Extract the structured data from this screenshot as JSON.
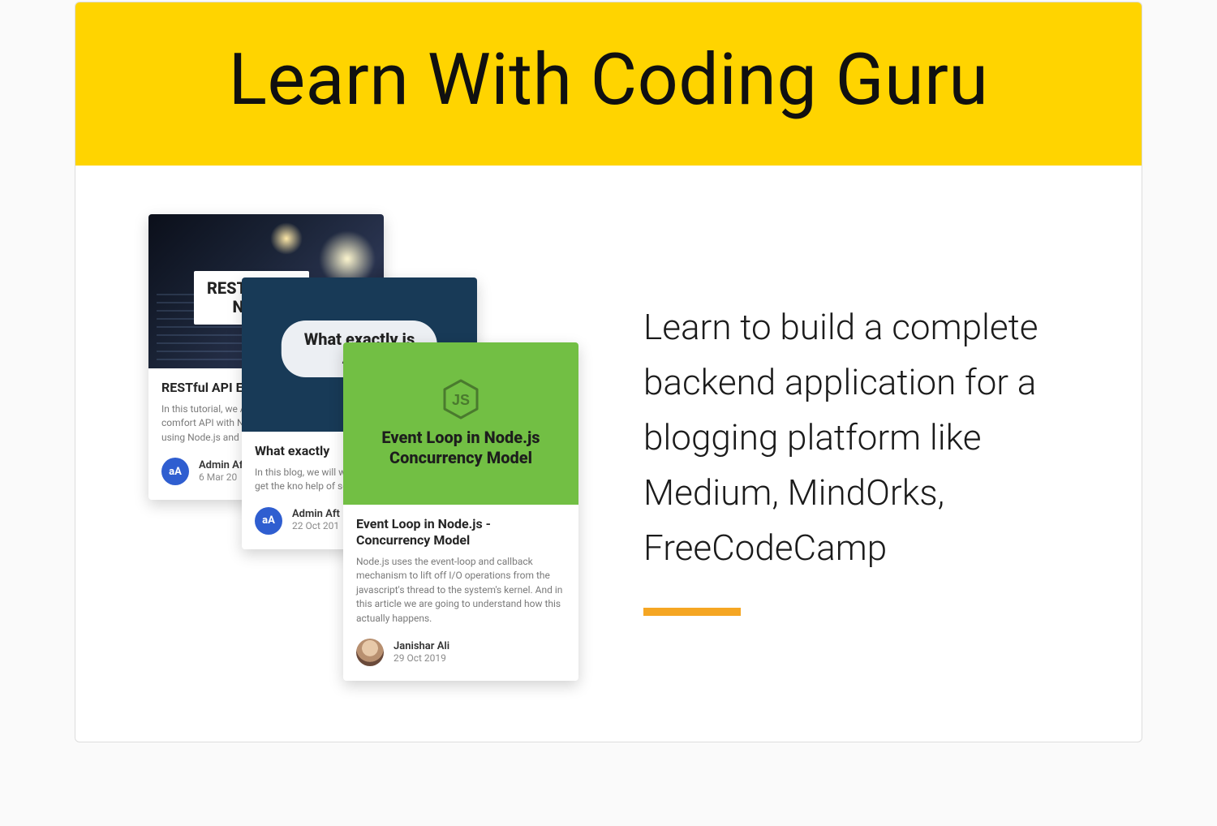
{
  "banner": {
    "title": "Learn With Coding Guru"
  },
  "cards": [
    {
      "hero_label": "RESTful API\nNode",
      "title": "RESTful API Express",
      "excerpt": "In this tutorial, we API using Node an make you comfort API with Node.js a blog, you will be a using Node.js and",
      "author": "Admin Af",
      "date": "6 Mar 20",
      "avatar_text": "aA"
    },
    {
      "hero_label": "What exactly is\nAPI?",
      "title": "What exactly",
      "excerpt": "In this blog, we will what exactly is API you will get the kno help of some conc example.",
      "author": "Admin Aft",
      "date": "22 Oct 201",
      "avatar_text": "aA"
    },
    {
      "hero_label": "Event Loop in Node.js\nConcurrency Model",
      "title": "Event Loop in Node.js - Concurrency Model",
      "excerpt": "Node.js uses the event-loop and callback mechanism to lift off I/O operations from the javascript's thread to the system's kernel. And in this article we are going to understand how this actually happens.",
      "author": "Janishar Ali",
      "date": "29 Oct 2019"
    }
  ],
  "right": {
    "lead": "Learn to build a complete backend application for a blogging platform like Medium, MindOrks, FreeCodeCamp"
  }
}
